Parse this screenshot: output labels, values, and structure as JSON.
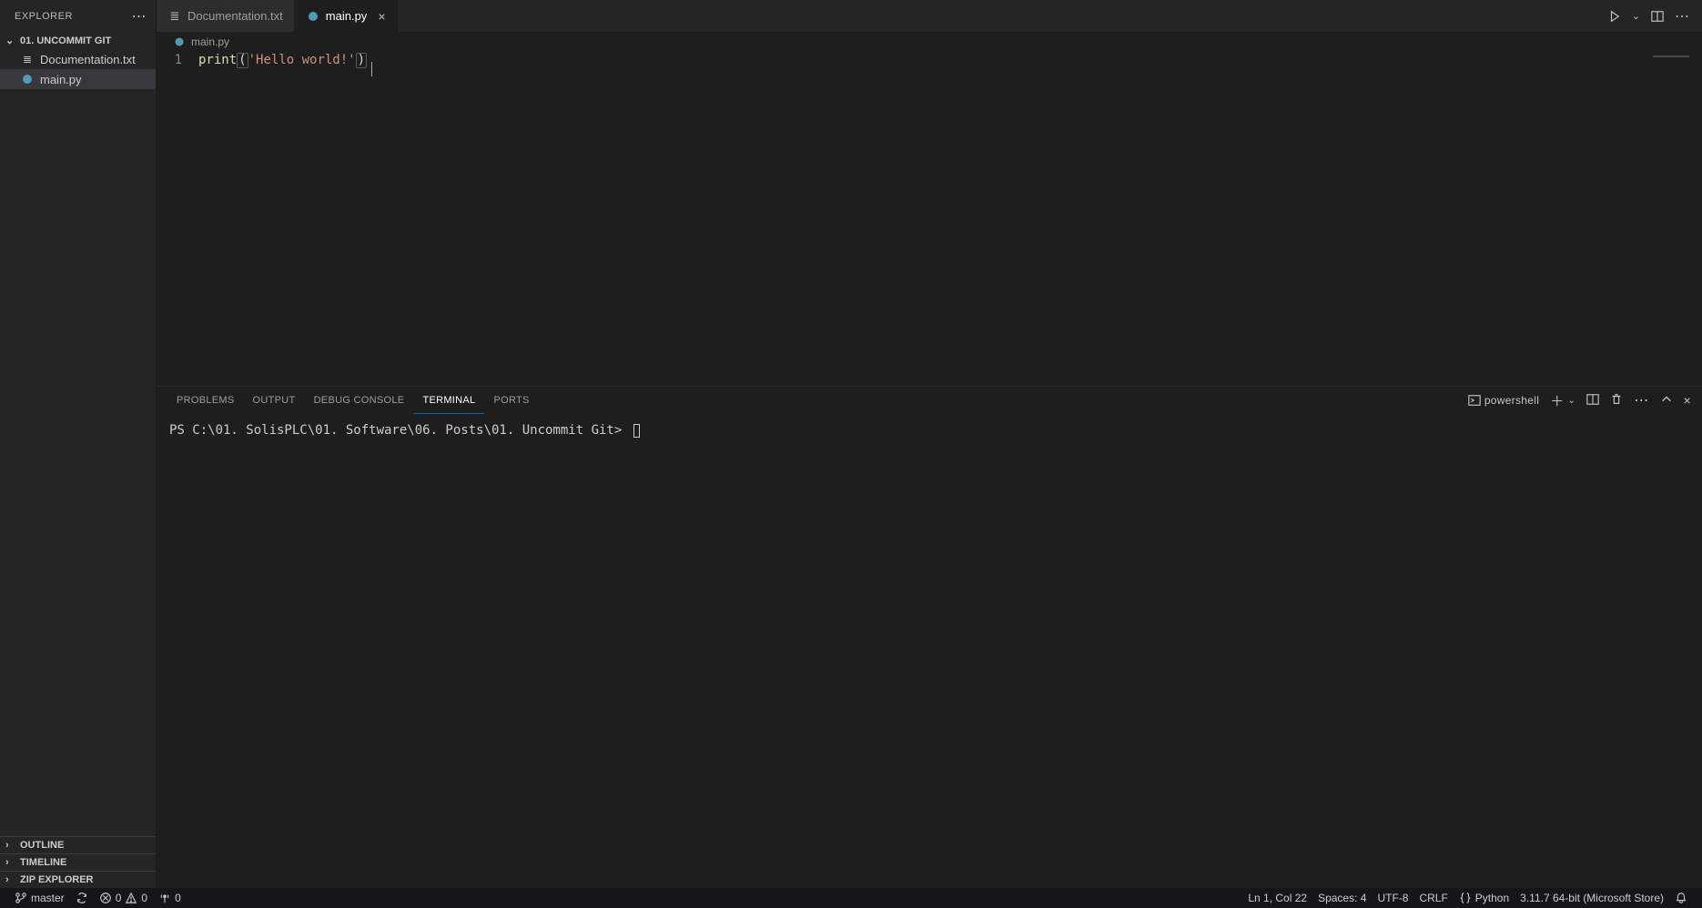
{
  "sidebar": {
    "title": "EXPLORER",
    "folder": "01. UNCOMMIT GIT",
    "files": [
      {
        "name": "Documentation.txt",
        "type": "txt"
      },
      {
        "name": "main.py",
        "type": "py"
      }
    ],
    "sections": [
      "OUTLINE",
      "TIMELINE",
      "ZIP EXPLORER"
    ]
  },
  "tabs": [
    {
      "label": "Documentation.txt",
      "type": "txt",
      "active": false
    },
    {
      "label": "main.py",
      "type": "py",
      "active": true
    }
  ],
  "breadcrumb": {
    "file": "main.py"
  },
  "editor": {
    "lineno": "1",
    "fn": "print",
    "open": "(",
    "str": "'Hello world!'",
    "close": ")"
  },
  "panel": {
    "tabs": [
      "PROBLEMS",
      "OUTPUT",
      "DEBUG CONSOLE",
      "TERMINAL",
      "PORTS"
    ],
    "active": "TERMINAL",
    "shell": "powershell",
    "prompt": "PS C:\\01. SolisPLC\\01. Software\\06. Posts\\01. Uncommit Git> "
  },
  "status": {
    "branch": "master",
    "errors": "0",
    "warnings": "0",
    "ports": "0",
    "lncol": "Ln 1, Col 22",
    "spaces": "Spaces: 4",
    "enc": "UTF-8",
    "eol": "CRLF",
    "lang": "Python",
    "interp": "3.11.7 64-bit (Microsoft Store)"
  }
}
